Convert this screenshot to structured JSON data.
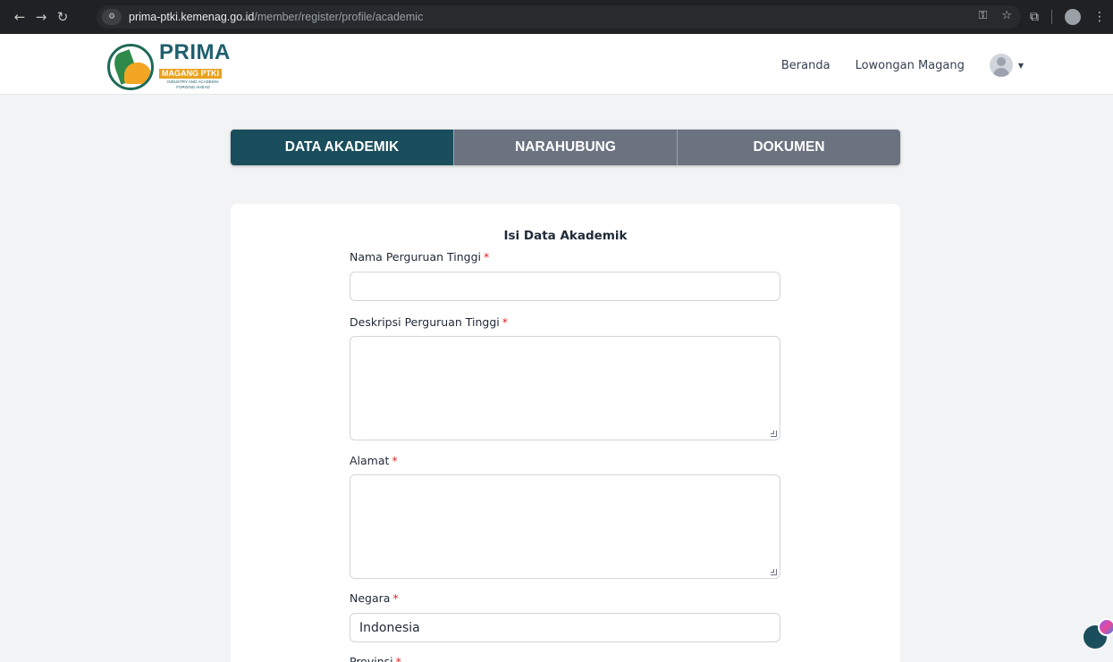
{
  "browser": {
    "url_host": "prima-ptki.kemenag.go.id",
    "url_path": "/member/register/profile/academic",
    "icons": [
      "back-icon",
      "forward-icon",
      "reload-icon",
      "site-info-icon",
      "key-icon",
      "star-icon",
      "extensions-icon",
      "profile-icon",
      "menu-icon"
    ]
  },
  "header": {
    "logo_title": "PRIMA",
    "logo_subtitle": "MAGANG PTKI",
    "logo_tagline": "INDUSTRY AND ACADEMIA FORGING AHEAD",
    "nav": [
      "Beranda",
      "Lowongan Magang"
    ]
  },
  "tabs": [
    {
      "label": "DATA AKADEMIK",
      "active": true
    },
    {
      "label": "NARAHUBUNG",
      "active": false
    },
    {
      "label": "DOKUMEN",
      "active": false
    }
  ],
  "form": {
    "title": "Isi Data Akademik",
    "required_mark": "*",
    "fields": {
      "nama_label": "Nama Perguruan Tinggi",
      "nama_value": "",
      "deskripsi_label": "Deskripsi Perguruan Tinggi",
      "alamat_label": "Alamat",
      "negara_label": "Negara",
      "negara_value": "Indonesia",
      "provinsi_label": "Provinsi"
    }
  },
  "colors": {
    "tab_active": "#1b4e5c",
    "tab_inactive": "#6b7280",
    "required": "#dc2626"
  }
}
